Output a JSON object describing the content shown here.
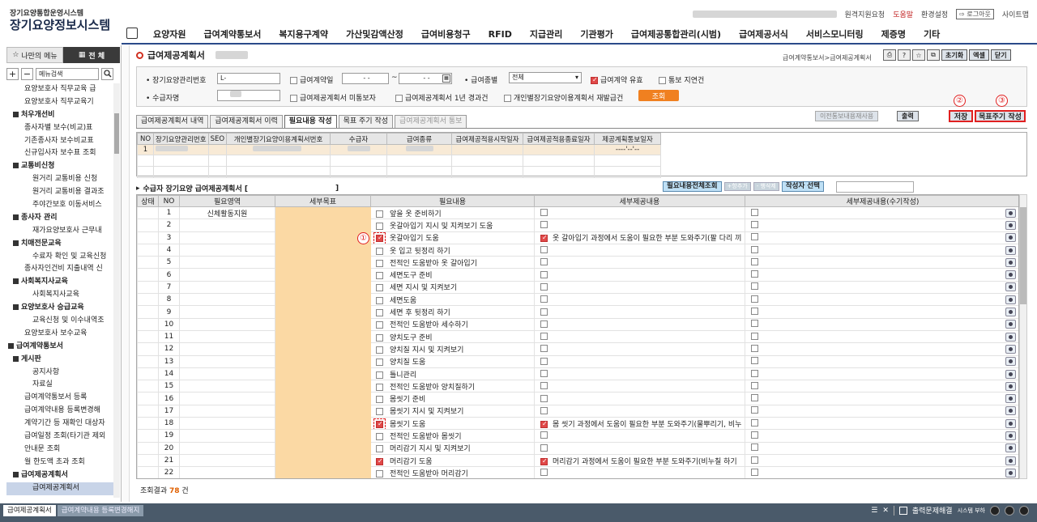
{
  "header": {
    "logo_sub": "장기요양통합운영시스템",
    "logo_main": "장기요양정보시스템",
    "links": {
      "remote": "원격지원요청",
      "help": "도움말",
      "settings": "환경설정",
      "logout": "로그아웃",
      "sitemap": "사이트맵"
    },
    "nav": [
      "요양자원",
      "급여계약통보서",
      "복지용구계약",
      "가산및감액산정",
      "급여비용청구",
      "RFID",
      "지급관리",
      "기관평가",
      "급여제공통합관리(시범)",
      "급여제공서식",
      "서비스모니터링",
      "제증명",
      "기타"
    ]
  },
  "sidebar": {
    "tab_my": "나만의 메뉴",
    "tab_all": "전 체",
    "search_placeholder": "메뉴검색",
    "items": [
      {
        "label": "요양보호사 직무교육 급",
        "lvl": "l3b"
      },
      {
        "label": "요양보호사 직무교육기",
        "lvl": "l3b"
      },
      {
        "label": "처우개선비",
        "lvl": "l2"
      },
      {
        "label": "종사자별 보수(비교)표",
        "lvl": "l3b"
      },
      {
        "label": "기존종사자 보수비교표",
        "lvl": "l3b"
      },
      {
        "label": "신규입사자 보수표 조회",
        "lvl": "l3b"
      },
      {
        "label": "교통비신청",
        "lvl": "l2"
      },
      {
        "label": "원거리 교통비용 신청",
        "lvl": "l3"
      },
      {
        "label": "원거리 교통비용 결과조",
        "lvl": "l3"
      },
      {
        "label": "주야간보호 이동서비스",
        "lvl": "l3"
      },
      {
        "label": "종사자 관리",
        "lvl": "l2"
      },
      {
        "label": "재가요양보호사 근무내",
        "lvl": "l3"
      },
      {
        "label": "치매전문교육",
        "lvl": "l2"
      },
      {
        "label": "수료자 확인 및 교육신청",
        "lvl": "l3"
      },
      {
        "label": "종사자인건비 지출내역 신",
        "lvl": "l3b"
      },
      {
        "label": "사회복지사교육",
        "lvl": "l2"
      },
      {
        "label": "사회복지사교육",
        "lvl": "l3"
      },
      {
        "label": "요양보호사 승급교육",
        "lvl": "l2"
      },
      {
        "label": "교육신청 및 이수내역조",
        "lvl": "l3"
      },
      {
        "label": "요양보호사 보수교육",
        "lvl": "l3b"
      },
      {
        "label": "급여계약통보서",
        "lvl": "l1"
      },
      {
        "label": "게시판",
        "lvl": "l2"
      },
      {
        "label": "공지사항",
        "lvl": "l3"
      },
      {
        "label": "자료실",
        "lvl": "l3"
      },
      {
        "label": "급여계약통보서 등록",
        "lvl": "l3b"
      },
      {
        "label": "급여계약내용 등록변경해",
        "lvl": "l3b"
      },
      {
        "label": "계약기간 등 재확인 대상자",
        "lvl": "l3b"
      },
      {
        "label": "급여일정 조회(타기관 제외",
        "lvl": "l3b"
      },
      {
        "label": "안내문 조회",
        "lvl": "l3b"
      },
      {
        "label": "월 한도액 초과 조회",
        "lvl": "l3b"
      },
      {
        "label": "급여제공계획서",
        "lvl": "l2"
      },
      {
        "label": "급여제공계획서",
        "lvl": "l3",
        "sel": true
      }
    ]
  },
  "page": {
    "title": "급여제공계획서",
    "breadcrumb": "급여계약통보서>급여제공계획서",
    "btn_init": "초기화",
    "btn_excel": "엑셀",
    "btn_close": "닫기"
  },
  "filter": {
    "ltc_no_label": "장기요양관리번호",
    "ltc_no_value": "L-",
    "contract_date_label": "급여계약일",
    "date_from": "-    -",
    "date_to": "-    -",
    "benefit_type_label": "급여종별",
    "benefit_type_value": "전체",
    "contract_valid_label": "급여계약 유효",
    "notice_delay_label": "통보 지연건",
    "recipient_label": "수급자명",
    "plan_unreported_label": "급여제공계획서 미통보자",
    "plan_over_year_label": "급여제공계획서 1년 경과건",
    "reissue_label": "개인별장기요양이용계획서 재발급건",
    "search_btn": "조회"
  },
  "tabs": [
    "급여제공계획서 내역",
    "급여제공계획서 이력",
    "필요내용 작성",
    "목표 주기 작성",
    "급여제공계획서 통보"
  ],
  "actions": {
    "prev_notice": "이전통보내용재사용",
    "print": "출력",
    "save": "저장",
    "goal_cycle": "목표주기 작성",
    "n1": "①",
    "n2": "②",
    "n3": "③"
  },
  "upper_grid": {
    "headers": [
      "NO",
      "장기요양관리번호",
      "SEO",
      "개인별장기요양이용계획서번호",
      "수급자",
      "급여종류",
      "급여제공적용시작일자",
      "급여제공적용종료일자",
      "제공계획통보일자"
    ],
    "row": {
      "no": "1",
      "notice_date": "----'--'--"
    }
  },
  "mid": {
    "caption": "수급자 장기요양 급여제공계획서 [",
    "caption_end": "]",
    "btn_all": "필요내용전체조회",
    "btn_add": "+항추가",
    "btn_del": "- 행삭제",
    "btn_writer": "작성자 선택"
  },
  "main_grid": {
    "headers": [
      "상태",
      "NO",
      "필요영역",
      "세부목표",
      "필요내용",
      "세부제공내용",
      "세부제공내용(수기작성)"
    ],
    "rows": [
      {
        "no": "1",
        "area": "신체활동지원",
        "need": "앞을 옷 준비하기",
        "c1": false,
        "c2": false,
        "detail": ""
      },
      {
        "no": "2",
        "area": "",
        "need": "옷갈아입기 지시 및 지켜보기 도움",
        "c1": false,
        "c2": false,
        "detail": ""
      },
      {
        "no": "3",
        "area": "",
        "need": "옷갈아입기 도움",
        "c1": true,
        "c2": true,
        "detail": "옷 갈아입기 과정에서 도움이 필요한 부분 도와주기(팔 다리 끼",
        "hl": true
      },
      {
        "no": "4",
        "area": "",
        "need": "옷 입고 뒷정리 하기",
        "c1": false,
        "c2": false,
        "detail": ""
      },
      {
        "no": "5",
        "area": "",
        "need": "전적인 도움받아 옷 갈아입기",
        "c1": false,
        "c2": false,
        "detail": ""
      },
      {
        "no": "6",
        "area": "",
        "need": "세면도구 준비",
        "c1": false,
        "c2": false,
        "detail": ""
      },
      {
        "no": "7",
        "area": "",
        "need": "세면 지시 및 지켜보기",
        "c1": false,
        "c2": false,
        "detail": ""
      },
      {
        "no": "8",
        "area": "",
        "need": "세면도움",
        "c1": false,
        "c2": false,
        "detail": ""
      },
      {
        "no": "9",
        "area": "",
        "need": "세면 후 뒷정리 하기",
        "c1": false,
        "c2": false,
        "detail": ""
      },
      {
        "no": "10",
        "area": "",
        "need": "전적인 도움받아 세수하기",
        "c1": false,
        "c2": false,
        "detail": ""
      },
      {
        "no": "11",
        "area": "",
        "need": "양치도구 준비",
        "c1": false,
        "c2": false,
        "detail": ""
      },
      {
        "no": "12",
        "area": "",
        "need": "양치질 지시 및 지켜보기",
        "c1": false,
        "c2": false,
        "detail": ""
      },
      {
        "no": "13",
        "area": "",
        "need": "양치질 도움",
        "c1": false,
        "c2": false,
        "detail": ""
      },
      {
        "no": "14",
        "area": "",
        "need": "틀니관리",
        "c1": false,
        "c2": false,
        "detail": ""
      },
      {
        "no": "15",
        "area": "",
        "need": "전적인 도움받아 양치질하기",
        "c1": false,
        "c2": false,
        "detail": ""
      },
      {
        "no": "16",
        "area": "",
        "need": "몸씻기 준비",
        "c1": false,
        "c2": false,
        "detail": ""
      },
      {
        "no": "17",
        "area": "",
        "need": "몸씻기 지시 및 지켜보기",
        "c1": false,
        "c2": false,
        "detail": ""
      },
      {
        "no": "18",
        "area": "",
        "need": "몸씻기 도움",
        "c1": true,
        "c2": true,
        "detail": "몸 씻기 과정에서 도움이 필요한 부분 도와주기(물뿌리기, 비누",
        "hl": true
      },
      {
        "no": "19",
        "area": "",
        "need": "전적인 도움받아 몸씻기",
        "c1": false,
        "c2": false,
        "detail": ""
      },
      {
        "no": "20",
        "area": "",
        "need": "머리감기 지시 및 지켜보기",
        "c1": false,
        "c2": false,
        "detail": ""
      },
      {
        "no": "21",
        "area": "",
        "need": "머리감기 도움",
        "c1": true,
        "c2": true,
        "detail": "머리감기 과정에서 도움이 필요한 부분 도와주기(비누칠 하기",
        "hl": false
      },
      {
        "no": "22",
        "area": "",
        "need": "전적인 도움받아 머리감기",
        "c1": false,
        "c2": false,
        "detail": ""
      }
    ]
  },
  "result": {
    "label": "조회결과",
    "count": "78",
    "unit": "건"
  },
  "bottom": {
    "tab1": "급여제공계획서",
    "tab2": "급여계약내용 등록변경해지",
    "print_issue": "출력문제해결",
    "sys_load": "시스템 부하"
  }
}
